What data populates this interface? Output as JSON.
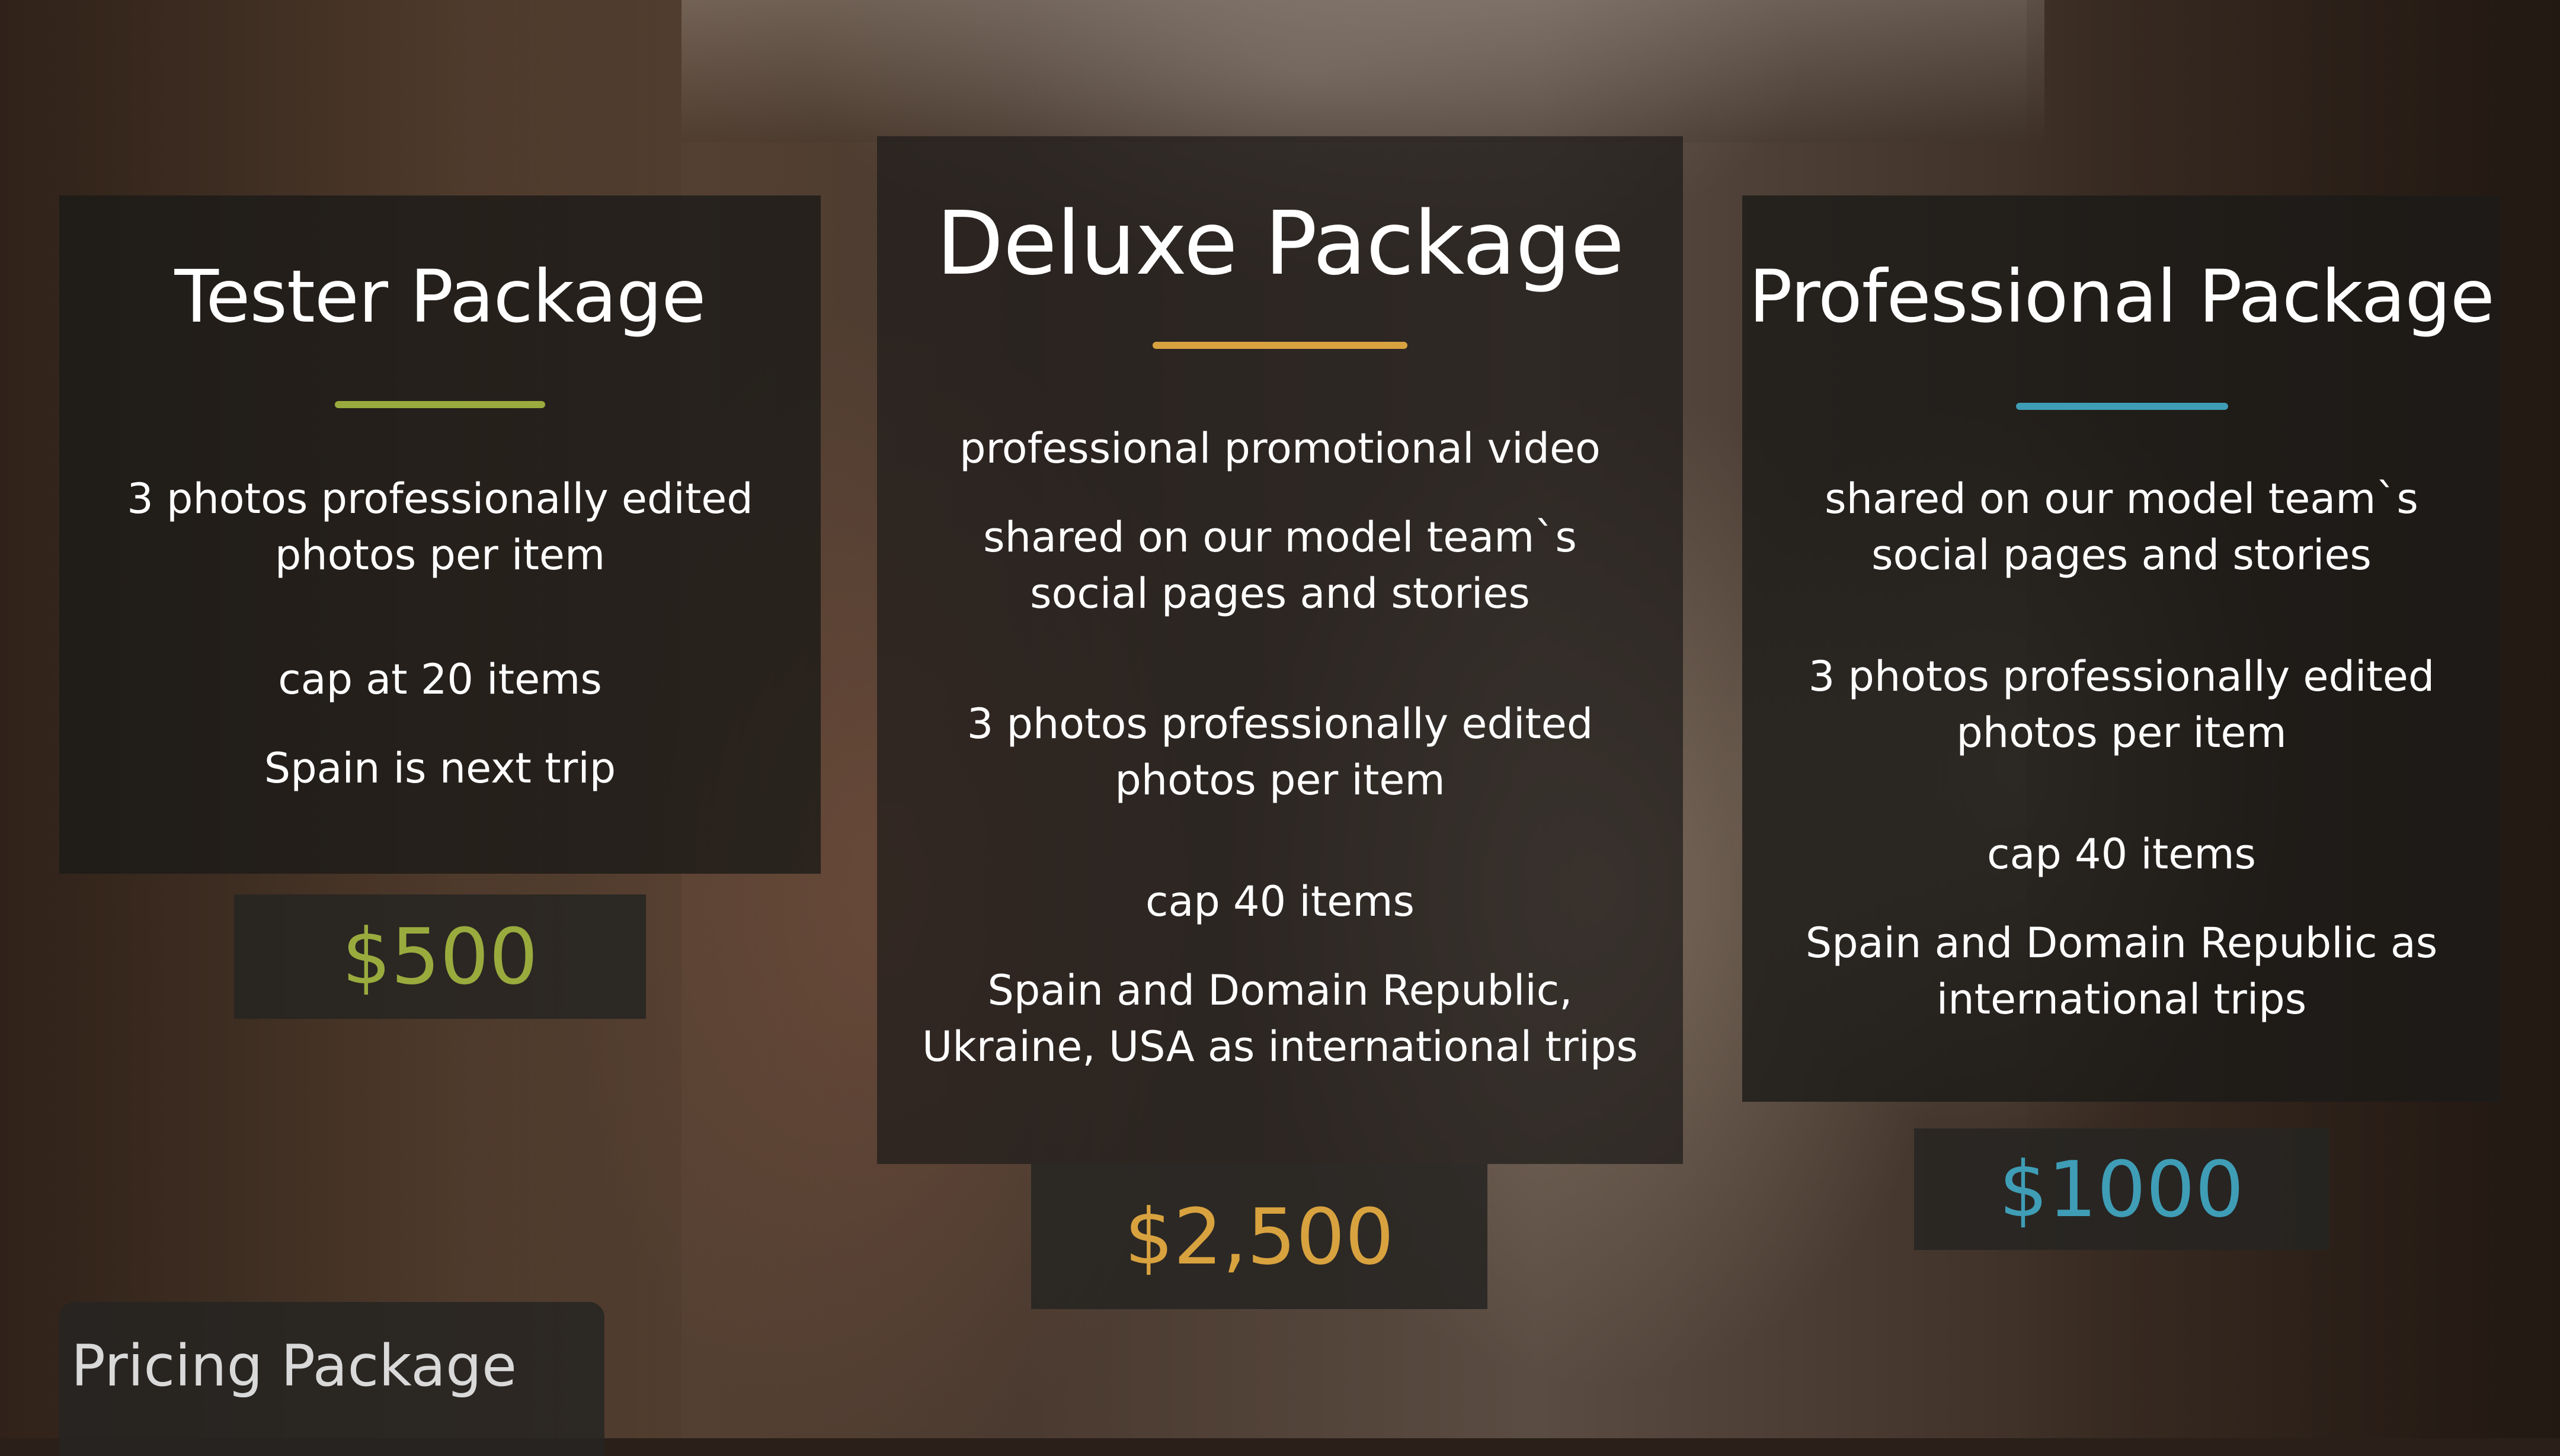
{
  "colors": {
    "tester_accent": "#9aab3e",
    "deluxe_accent": "#d8a23f",
    "professional_accent": "#3f9db6"
  },
  "tester": {
    "title": "Tester Package",
    "features": [
      "3 photos professionally edited\nphotos per item",
      "cap at 20 items",
      "Spain is next trip"
    ],
    "price": "$500"
  },
  "deluxe": {
    "title": "Deluxe Package",
    "features": [
      "professional promotional video",
      "shared on our model team`s\nsocial pages and stories",
      "3 photos professionally edited\nphotos per item",
      "cap 40 items",
      "Spain and Domain Republic,\nUkraine, USA as international trips"
    ],
    "price": "$2,500"
  },
  "professional": {
    "title": "Professional Package",
    "features": [
      "shared on our model team`s\nsocial pages and stories",
      "3 photos professionally edited\nphotos per item",
      "cap 40 items",
      "Spain and Domain Republic as\ninternational trips"
    ],
    "price": "$1000"
  },
  "footer": {
    "label": "Pricing Package"
  }
}
